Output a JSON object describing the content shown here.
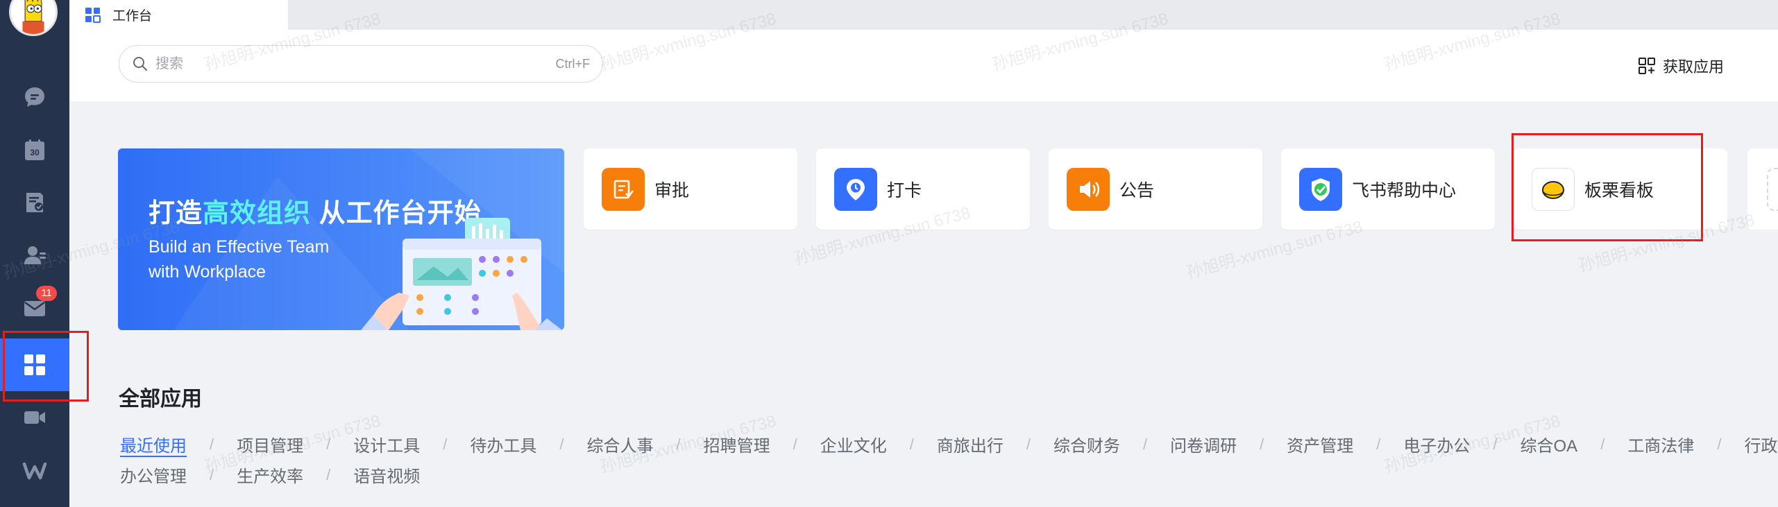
{
  "tab": {
    "label": "工作台"
  },
  "search": {
    "placeholder": "搜索",
    "shortcut": "Ctrl+F"
  },
  "header": {
    "get_apps_label": "获取应用"
  },
  "nav": {
    "message_badge": "11"
  },
  "banner": {
    "title_prefix": "打造",
    "title_highlight": "高效组织",
    "title_suffix": " 从工作台开始",
    "subtitle": "Build an Effective Team\nwith Workplace"
  },
  "cards": [
    {
      "label": "审批",
      "icon": "approval-icon",
      "color": "#f87e0a"
    },
    {
      "label": "打卡",
      "icon": "clock-in-icon",
      "color": "#3370ff"
    },
    {
      "label": "公告",
      "icon": "announcement-icon",
      "color": "#f87e0a"
    },
    {
      "label": "飞书帮助中心",
      "icon": "help-center-icon",
      "color": "#3370ff"
    },
    {
      "label": "板栗看板",
      "icon": "chestnut-board-icon",
      "color": "#ffc60a"
    }
  ],
  "all_apps": {
    "title": "全部应用",
    "row1": [
      "最近使用",
      "项目管理",
      "设计工具",
      "待办工具",
      "综合人事",
      "招聘管理",
      "企业文化",
      "商旅出行",
      "综合财务",
      "问卷调研",
      "资产管理",
      "电子办公",
      "综合OA",
      "工商法律",
      "行政"
    ],
    "row2": [
      "办公管理",
      "生产效率",
      "语音视频"
    ]
  },
  "watermark": "孙旭明-xvming.sun 6738",
  "colors": {
    "sidebar": "#26334d",
    "accent": "#3370ff",
    "highlight": "#e02020",
    "background": "#f1f2f5"
  }
}
